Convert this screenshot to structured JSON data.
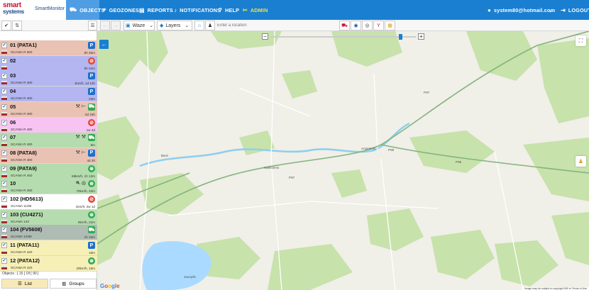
{
  "brand": {
    "logo_top": "smart",
    "logo_bottom": "systems",
    "product": "SmartMonitor"
  },
  "nav": {
    "items": [
      {
        "label": "OBJECTS",
        "icon": "car-icon"
      },
      {
        "label": "GEOZONES",
        "icon": "map-pin-icon"
      },
      {
        "label": "REPORTS",
        "icon": "document-icon"
      },
      {
        "label": "NOTIFICATIONS",
        "icon": "bell-icon"
      },
      {
        "label": "HELP",
        "icon": "question-icon"
      },
      {
        "label": "ADMIN",
        "icon": "tools-icon"
      }
    ],
    "user_email": "system80@hotmail.com",
    "logout": "LOGOUT"
  },
  "toolbar": {
    "map_provider": "Waze",
    "layers_label": "Layers",
    "location_placeholder": "Enter a location"
  },
  "vehicles": [
    {
      "name": "01 (PATA1)",
      "model": "SCANIA R 500",
      "sub": "9h 36m",
      "status": "park",
      "status_glyph": "P",
      "bg": "#e9c2b3",
      "extra": ""
    },
    {
      "name": "02",
      "model": "",
      "sub": "9h 34m",
      "status": "stop",
      "status_glyph": "⊘",
      "bg": "#b3b6f0",
      "extra": ""
    },
    {
      "name": "03",
      "model": "SCANIA R 480",
      "sub": "1km/h, 1d 14h",
      "status": "park",
      "status_glyph": "P",
      "bg": "#b3b6f0",
      "extra": ""
    },
    {
      "name": "04",
      "model": "SCANIA R 480",
      "sub": "23m",
      "status": "park",
      "status_glyph": "P",
      "bg": "#b3b6f0",
      "extra": ""
    },
    {
      "name": "05",
      "model": "SCANIA R 480",
      "sub": "5d 16h",
      "status": "car",
      "status_glyph": "⛟",
      "bg": "#e9c2b3",
      "extra": "⚒ ⊢"
    },
    {
      "name": "06",
      "model": "SCANIA R 480",
      "sub": "1w 3d",
      "status": "stop",
      "status_glyph": "⊘",
      "bg": "#f7c4f2",
      "extra": ""
    },
    {
      "name": "07",
      "model": "SCANIA R 480",
      "sub": "9m",
      "status": "car",
      "status_glyph": "⛟",
      "bg": "#b5dcae",
      "extra": "⚒ ⚒"
    },
    {
      "name": "08 (PATA8)",
      "model": "SCANIA R 480",
      "sub": "4d 3h",
      "status": "park",
      "status_glyph": "P",
      "bg": "#e9c2b3",
      "extra": "⚒ ⊢"
    },
    {
      "name": "09 (PATA9)",
      "model": "SCANIA R 450",
      "sub": "68km/h, 1h 13m",
      "status": "move",
      "status_glyph": "⊛",
      "bg": "#b5dcae",
      "extra": ""
    },
    {
      "name": "10",
      "model": "SCANIA R 480",
      "sub": "70km/h, 33m",
      "status": "move",
      "status_glyph": "⊛",
      "bg": "#b5dcae",
      "extra": "⛐ ⊛"
    },
    {
      "name": "102 (HD5613)",
      "model": "SCANIA 113M",
      "sub": "1km/h, 2w 1d",
      "status": "stop",
      "status_glyph": "⊘",
      "bg": "#ffffff",
      "extra": ""
    },
    {
      "name": "103 (CU4271)",
      "model": "SCANIA 143",
      "sub": "6km/h, 22m",
      "status": "move",
      "status_glyph": "⊛",
      "bg": "#b5dcae",
      "extra": ""
    },
    {
      "name": "104 (FV5608)",
      "model": "SCANIA 143M",
      "sub": "1h 10m",
      "status": "car",
      "status_glyph": "⛟",
      "bg": "#aebcb4",
      "extra": ""
    },
    {
      "name": "11 (PATA11)",
      "model": "SCANIA R 420",
      "sub": "18m",
      "status": "park",
      "status_glyph": "P",
      "bg": "#f7f0b6",
      "extra": ""
    },
    {
      "name": "12 (PATA12)",
      "model": "SCANIA R 420",
      "sub": "20km/h, 16m",
      "status": "move",
      "status_glyph": "⊛",
      "bg": "#f7f0b6",
      "extra": ""
    }
  ],
  "sidebar_footer": "Objects : [ 15 ] Of [ 90 ]",
  "sidebar_tabs": {
    "list": "List",
    "groups": "Groups"
  },
  "map": {
    "places": [
      "Biezi",
      "Kalnciems",
      "Annenieki",
      "Jaunpils"
    ],
    "road_labels": [
      "P97",
      "P99",
      "P98",
      "P97"
    ],
    "attribution": "Image may be subject to copyright   500 m   Terms of Use",
    "google": "Google"
  }
}
